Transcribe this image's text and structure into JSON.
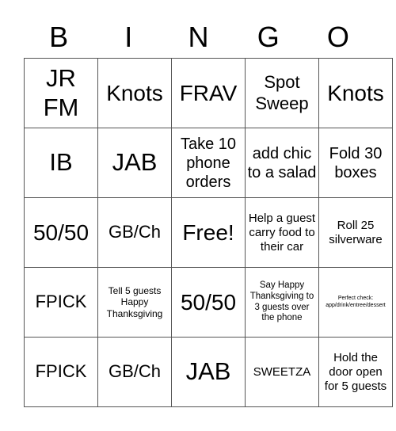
{
  "header": {
    "letters": [
      "B",
      "I",
      "N",
      "G",
      "O"
    ]
  },
  "grid": {
    "rows": [
      [
        "JR FM",
        "Knots",
        "FRAV",
        "Spot Sweep",
        "Knots"
      ],
      [
        "IB",
        "JAB",
        "Take 10 phone orders",
        "add chic to a salad",
        "Fold 30 boxes"
      ],
      [
        "50/50",
        "GB/Ch",
        "Free!",
        "Help a guest carry food to their car",
        "Roll 25 silverware"
      ],
      [
        "FPICK",
        "Tell 5 guests Happy Thanksgiving",
        "50/50",
        "Say Happy Thanksgiving to 3 guests over the phone",
        "Perfect check: app/drink/entree/dessert"
      ],
      [
        "FPICK",
        "GB/Ch",
        "JAB",
        "SWEETZA",
        "Hold the door open for 5 guests"
      ]
    ]
  }
}
